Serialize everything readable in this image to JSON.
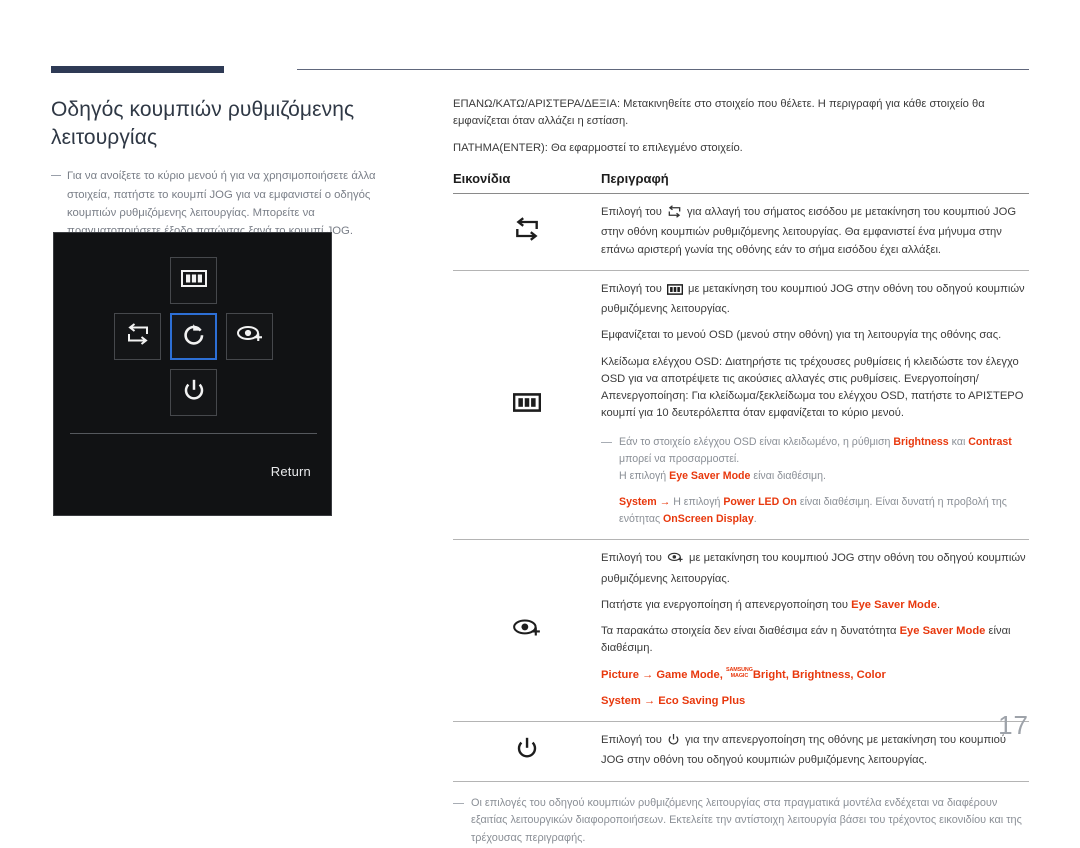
{
  "page": {
    "number": "17"
  },
  "left": {
    "title": "Οδηγός κουμπιών ρυθμιζόμενης λειτουργίας",
    "note": "Για να ανοίξετε το κύριο μενού ή για να χρησιμοποιήσετε άλλα στοιχεία, πατήστε το κουμπί JOG για να εμφανιστεί ο οδηγός κουμπιών ρυθμιζόμενης λειτουργίας. Μπορείτε να πραγματοποιήσετε έξοδο πατώντας ξανά το κουμπί JOG."
  },
  "osd": {
    "buttons": {
      "top": "menu-icon",
      "left": "source-swap-icon",
      "center": "return-arrow-icon",
      "right": "eye-saver-icon",
      "bottom": "power-icon"
    },
    "selected": "center",
    "return_label": "Return",
    "selected_border_color": "#2d6fd6",
    "background_color": "#111214"
  },
  "right": {
    "intro": [
      "ΕΠΑΝΩ/ΚΑΤΩ/ΑΡΙΣΤΕΡΑ/ΔΕΞΙΑ: Μετακινηθείτε στο στοιχείο που θέλετε. Η περιγραφή για κάθε στοιχείο θα εμφανίζεται όταν αλλάζει η εστίαση.",
      "ΠΑΤΗΜΑ(ENTER): Θα εφαρμοστεί το επιλεγμένο στοιχείο."
    ],
    "table": {
      "headers": [
        "Εικονίδια",
        "Περιγραφή"
      ],
      "rows": [
        {
          "icon": "source-swap-icon",
          "paragraphs": [
            {
              "parts": [
                {
                  "t": "text",
                  "v": "Επιλογή του "
                },
                {
                  "t": "icon",
                  "v": "source-swap-icon"
                },
                {
                  "t": "text",
                  "v": " για αλλαγή του σήματος εισόδου με μετακίνηση του κουμπιού JOG στην οθόνη κουμπιών ρυθμιζόμενης λειτουργίας. Θα εμφανιστεί ένα μήνυμα στην επάνω αριστερή γωνία της οθόνης εάν το σήμα εισόδου έχει αλλάξει."
                }
              ]
            }
          ]
        },
        {
          "icon": "menu-icon",
          "paragraphs": [
            {
              "parts": [
                {
                  "t": "text",
                  "v": "Επιλογή του "
                },
                {
                  "t": "icon",
                  "v": "menu-icon"
                },
                {
                  "t": "text",
                  "v": " με μετακίνηση του κουμπιού JOG στην οθόνη του οδηγού κουμπιών ρυθμιζόμενης λειτουργίας."
                }
              ]
            },
            {
              "parts": [
                {
                  "t": "text",
                  "v": "Εμφανίζεται το μενού OSD (μενού στην οθόνη) για τη λειτουργία της οθόνης σας."
                }
              ]
            },
            {
              "parts": [
                {
                  "t": "text",
                  "v": "Κλείδωμα ελέγχου OSD: Διατηρήστε τις τρέχουσες ρυθμίσεις ή κλειδώστε τον έλεγχο OSD για να αποτρέψετε τις ακούσιες αλλαγές στις ρυθμίσεις. Ενεργοποίηση/Απενεργοποίηση: Για κλείδωμα/ξεκλείδωμα του ελέγχου OSD, πατήστε το ΑΡΙΣΤΕΡΟ κουμπί για 10 δευτερόλεπτα όταν εμφανίζεται το κύριο μενού."
                }
              ]
            }
          ],
          "subnote": [
            {
              "parts": [
                {
                  "t": "text",
                  "v": "Εάν το στοιχείο ελέγχου OSD είναι κλειδωμένο, η ρύθμιση "
                },
                {
                  "t": "red",
                  "v": "Brightness"
                },
                {
                  "t": "text",
                  "v": " και "
                },
                {
                  "t": "red",
                  "v": "Contrast"
                },
                {
                  "t": "text",
                  "v": " μπορεί να προσαρμοστεί."
                },
                {
                  "t": "br",
                  "v": ""
                },
                {
                  "t": "text",
                  "v": "Η επιλογή "
                },
                {
                  "t": "red",
                  "v": "Eye Saver Mode"
                },
                {
                  "t": "text",
                  "v": " είναι διαθέσιμη."
                }
              ]
            },
            {
              "parts": [
                {
                  "t": "red",
                  "v": "System"
                },
                {
                  "t": "red",
                  "v": " → "
                },
                {
                  "t": "text",
                  "v": "Η επιλογή "
                },
                {
                  "t": "red",
                  "v": "Power LED On"
                },
                {
                  "t": "text",
                  "v": " είναι διαθέσιμη. Είναι δυνατή η προβολή της ενότητας "
                },
                {
                  "t": "red",
                  "v": "OnScreen Display"
                },
                {
                  "t": "text",
                  "v": "."
                }
              ]
            }
          ]
        },
        {
          "icon": "eye-saver-icon",
          "paragraphs": [
            {
              "parts": [
                {
                  "t": "text",
                  "v": "Επιλογή του "
                },
                {
                  "t": "icon",
                  "v": "eye-saver-icon"
                },
                {
                  "t": "text",
                  "v": " με μετακίνηση του κουμπιού JOG στην οθόνη του οδηγού κουμπιών ρυθμιζόμενης λειτουργίας."
                }
              ]
            },
            {
              "parts": [
                {
                  "t": "text",
                  "v": "Πατήστε για ενεργοποίηση ή απενεργοποίηση του "
                },
                {
                  "t": "red",
                  "v": "Eye Saver Mode"
                },
                {
                  "t": "text",
                  "v": "."
                }
              ]
            },
            {
              "parts": [
                {
                  "t": "text",
                  "v": "Τα παρακάτω στοιχεία δεν είναι διαθέσιμα εάν η δυνατότητα "
                },
                {
                  "t": "red",
                  "v": "Eye Saver Mode"
                },
                {
                  "t": "text",
                  "v": " είναι διαθέσιμη."
                }
              ]
            },
            {
              "parts": [
                {
                  "t": "red",
                  "v": "Picture → Game Mode, "
                },
                {
                  "t": "magic",
                  "v": "SAMSUNG|MAGIC"
                },
                {
                  "t": "red",
                  "v": "Bright, Brightness, Color"
                }
              ]
            },
            {
              "parts": [
                {
                  "t": "red",
                  "v": "System → Eco Saving Plus"
                }
              ]
            }
          ]
        },
        {
          "icon": "power-icon",
          "paragraphs": [
            {
              "parts": [
                {
                  "t": "text",
                  "v": "Επιλογή του "
                },
                {
                  "t": "icon",
                  "v": "power-icon"
                },
                {
                  "t": "text",
                  "v": " για την απενεργοποίηση της οθόνης με μετακίνηση του κουμπιού JOG στην οθόνη του οδηγού κουμπιών ρυθμιζόμενης λειτουργίας."
                }
              ]
            }
          ]
        }
      ]
    },
    "footer_note": "Οι επιλογές του οδηγού κουμπιών ρυθμιζόμενης λειτουργίας στα πραγματικά μοντέλα ενδέχεται να διαφέρουν εξαιτίας λειτουργικών διαφοροποιήσεων. Εκτελείτε την αντίστοιχη λειτουργία βάσει του τρέχοντος εικονιδίου και της τρέχουσας περιγραφής."
  },
  "colors": {
    "accent_red": "#e8380d",
    "header_bar": "#2e3a55",
    "title": "#2f3845"
  }
}
